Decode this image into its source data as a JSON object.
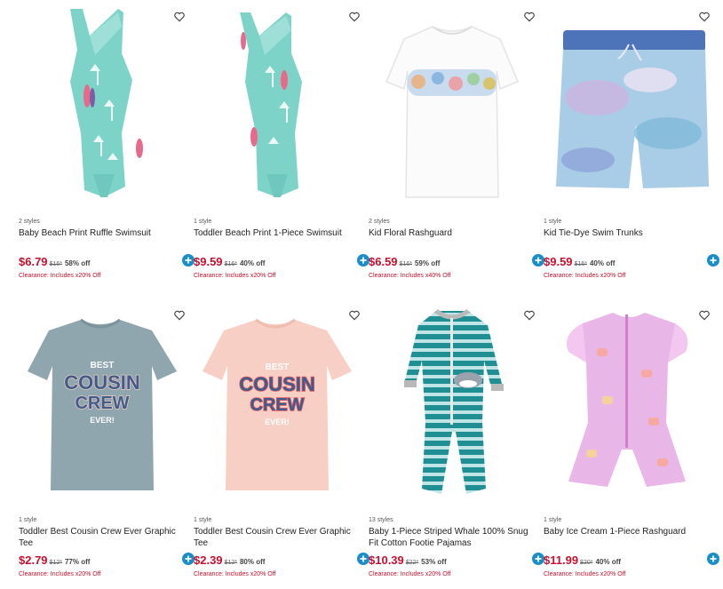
{
  "products": [
    {
      "styles": "2 styles",
      "name": "Baby Beach Print Ruffle Swimsuit",
      "price": "$6.79",
      "original": "$16*",
      "discount": "58% off",
      "promo": "Clearance: Includes x20% Off",
      "image": "teal-palm-one-shoulder-ruffle-swimsuit"
    },
    {
      "styles": "1 style",
      "name": "Toddler Beach Print 1-Piece Swimsuit",
      "price": "$9.59",
      "original": "$16*",
      "discount": "40% off",
      "promo": "Clearance: Includes x20% Off",
      "image": "teal-palm-one-piece-swimsuit"
    },
    {
      "styles": "2 styles",
      "name": "Kid Floral Rashguard",
      "price": "$6.59",
      "original": "$16*",
      "discount": "59% off",
      "promo": "Clearance: Includes x40% Off",
      "image": "white-floral-rashguard"
    },
    {
      "styles": "1 style",
      "name": "Kid Tie-Dye Swim Trunks",
      "price": "$9.59",
      "original": "$16*",
      "discount": "40% off",
      "promo": "Clearance: Includes x20% Off",
      "image": "tie-dye-swim-trunks"
    },
    {
      "styles": "1 style",
      "name": "Toddler Best Cousin Crew Ever Graphic Tee",
      "price": "$2.79",
      "original": "$12*",
      "discount": "77% off",
      "promo": "Clearance: Includes x20% Off",
      "image": "gray-best-cousin-crew-tee",
      "tee_text": [
        "BEST",
        "COUSIN",
        "CREW",
        "EVER!"
      ]
    },
    {
      "styles": "1 style",
      "name": "Toddler Best Cousin Crew Ever Graphic Tee",
      "price": "$2.39",
      "original": "$12*",
      "discount": "80% off",
      "promo": "Clearance: Includes x20% Off",
      "image": "pink-best-cousin-crew-tee",
      "tee_text": [
        "BEST",
        "COUSIN",
        "CREW",
        "EVER!"
      ]
    },
    {
      "styles": "13 styles",
      "name": "Baby 1-Piece Striped Whale 100% Snug Fit Cotton Footie Pajamas",
      "price": "$10.39",
      "original": "$22*",
      "discount": "53% off",
      "promo": "Clearance: Includes x20% Off",
      "image": "teal-striped-whale-footie-pajamas"
    },
    {
      "styles": "1 style",
      "name": "Baby Ice Cream 1-Piece Rashguard",
      "price": "$11.99",
      "original": "$20*",
      "discount": "40% off",
      "promo": "Clearance: Includes x20% Off",
      "image": "pink-ice-cream-rashguard"
    }
  ],
  "icons": {
    "favorite": "heart-outline-icon",
    "add": "plus-circle-icon"
  },
  "colors": {
    "sale_price": "#c8102e",
    "add_button": "#1a8ec9",
    "promo": "#c8102e"
  }
}
